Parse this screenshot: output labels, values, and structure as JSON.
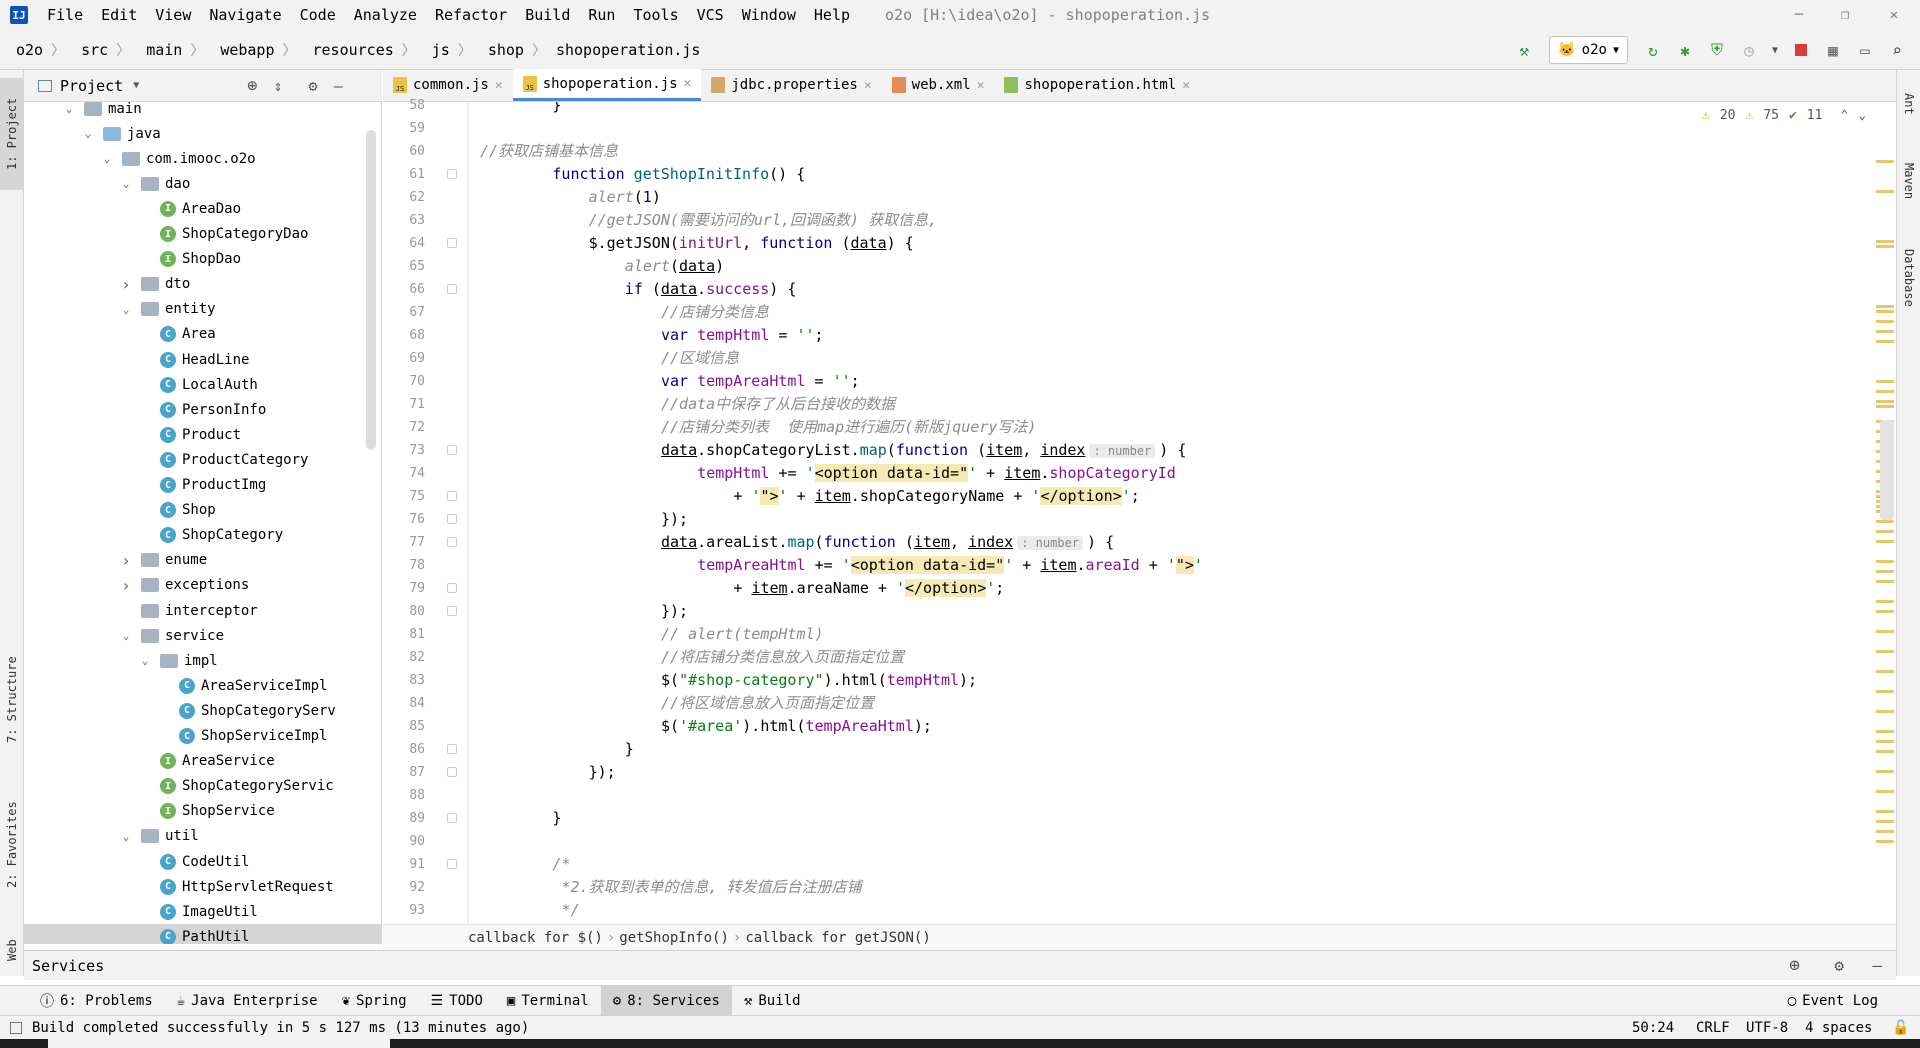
{
  "menu": {
    "items": [
      "File",
      "Edit",
      "View",
      "Navigate",
      "Code",
      "Analyze",
      "Refactor",
      "Build",
      "Run",
      "Tools",
      "VCS",
      "Window",
      "Help"
    ],
    "title": "o2o [H:\\idea\\o2o] - shopoperation.js"
  },
  "breadcrumb": [
    "o2o",
    "src",
    "main",
    "webapp",
    "resources",
    "js",
    "shop",
    "shopoperation.js"
  ],
  "run_config": "o2o",
  "left_tabs": {
    "project": "1: Project",
    "structure": "7: Structure",
    "favorites": "2: Favorites",
    "web": "Web"
  },
  "right_tabs": {
    "ant": "Ant",
    "maven": "Maven",
    "database": "Database"
  },
  "project_panel": {
    "title": "Project"
  },
  "tree": [
    {
      "label": "main",
      "depth": 0,
      "arrow": "open",
      "icon": "folder"
    },
    {
      "label": "java",
      "depth": 1,
      "arrow": "open",
      "icon": "folder-blue"
    },
    {
      "label": "com.imooc.o2o",
      "depth": 2,
      "arrow": "open",
      "icon": "folder"
    },
    {
      "label": "dao",
      "depth": 3,
      "arrow": "open",
      "icon": "folder"
    },
    {
      "label": "AreaDao",
      "depth": 4,
      "arrow": "",
      "icon": "I"
    },
    {
      "label": "ShopCategoryDao",
      "depth": 4,
      "arrow": "",
      "icon": "I"
    },
    {
      "label": "ShopDao",
      "depth": 4,
      "arrow": "",
      "icon": "I"
    },
    {
      "label": "dto",
      "depth": 3,
      "arrow": "closed",
      "icon": "folder"
    },
    {
      "label": "entity",
      "depth": 3,
      "arrow": "open",
      "icon": "folder"
    },
    {
      "label": "Area",
      "depth": 4,
      "arrow": "",
      "icon": "C"
    },
    {
      "label": "HeadLine",
      "depth": 4,
      "arrow": "",
      "icon": "C"
    },
    {
      "label": "LocalAuth",
      "depth": 4,
      "arrow": "",
      "icon": "C"
    },
    {
      "label": "PersonInfo",
      "depth": 4,
      "arrow": "",
      "icon": "C"
    },
    {
      "label": "Product",
      "depth": 4,
      "arrow": "",
      "icon": "C"
    },
    {
      "label": "ProductCategory",
      "depth": 4,
      "arrow": "",
      "icon": "C"
    },
    {
      "label": "ProductImg",
      "depth": 4,
      "arrow": "",
      "icon": "C"
    },
    {
      "label": "Shop",
      "depth": 4,
      "arrow": "",
      "icon": "C"
    },
    {
      "label": "ShopCategory",
      "depth": 4,
      "arrow": "",
      "icon": "C"
    },
    {
      "label": "enume",
      "depth": 3,
      "arrow": "closed",
      "icon": "folder"
    },
    {
      "label": "exceptions",
      "depth": 3,
      "arrow": "closed",
      "icon": "folder"
    },
    {
      "label": "interceptor",
      "depth": 3,
      "arrow": "",
      "icon": "folder"
    },
    {
      "label": "service",
      "depth": 3,
      "arrow": "open",
      "icon": "folder"
    },
    {
      "label": "impl",
      "depth": 4,
      "arrow": "open",
      "icon": "folder"
    },
    {
      "label": "AreaServiceImpl",
      "depth": 5,
      "arrow": "",
      "icon": "C"
    },
    {
      "label": "ShopCategoryServ",
      "depth": 5,
      "arrow": "",
      "icon": "C"
    },
    {
      "label": "ShopServiceImpl",
      "depth": 5,
      "arrow": "",
      "icon": "C"
    },
    {
      "label": "AreaService",
      "depth": 4,
      "arrow": "",
      "icon": "I"
    },
    {
      "label": "ShopCategoryServic",
      "depth": 4,
      "arrow": "",
      "icon": "I"
    },
    {
      "label": "ShopService",
      "depth": 4,
      "arrow": "",
      "icon": "I"
    },
    {
      "label": "util",
      "depth": 3,
      "arrow": "open",
      "icon": "folder"
    },
    {
      "label": "CodeUtil",
      "depth": 4,
      "arrow": "",
      "icon": "C"
    },
    {
      "label": "HttpServletRequest",
      "depth": 4,
      "arrow": "",
      "icon": "C"
    },
    {
      "label": "ImageUtil",
      "depth": 4,
      "arrow": "",
      "icon": "C"
    },
    {
      "label": "PathUtil",
      "depth": 4,
      "arrow": "",
      "icon": "C"
    }
  ],
  "tabs": [
    {
      "label": "common.js",
      "icon": "js",
      "active": false
    },
    {
      "label": "shopoperation.js",
      "icon": "js",
      "active": true
    },
    {
      "label": "jdbc.properties",
      "icon": "prop",
      "active": false
    },
    {
      "label": "web.xml",
      "icon": "xml",
      "active": false
    },
    {
      "label": "shopoperation.html",
      "icon": "html",
      "active": false
    }
  ],
  "inspections": {
    "warn1": "20",
    "warn2": "75",
    "ok": "11"
  },
  "line_numbers": [
    "58",
    "59",
    "60",
    "61",
    "62",
    "63",
    "64",
    "65",
    "66",
    "67",
    "68",
    "69",
    "70",
    "71",
    "72",
    "73",
    "74",
    "75",
    "76",
    "77",
    "78",
    "79",
    "80",
    "81",
    "82",
    "83",
    "84",
    "85",
    "86",
    "87",
    "88",
    "89",
    "90",
    "91",
    "92",
    "93"
  ],
  "code": [
    {
      "indent": 8,
      "tokens": [
        [
          "pl",
          "}"
        ]
      ]
    },
    {
      "indent": 0,
      "tokens": []
    },
    {
      "indent": 0,
      "tokens": [
        [
          "cm",
          "//获取店铺基本信息"
        ]
      ]
    },
    {
      "indent": 8,
      "tokens": [
        [
          "kw",
          "function "
        ],
        [
          "fn",
          "getShopInitInfo"
        ],
        [
          "pl",
          "() {"
        ]
      ]
    },
    {
      "indent": 12,
      "tokens": [
        [
          "cm",
          "alert"
        ],
        [
          "pl",
          "("
        ],
        [
          "kw",
          "1"
        ],
        [
          "pl",
          ")"
        ]
      ]
    },
    {
      "indent": 12,
      "tokens": [
        [
          "cm",
          "//getJSON(需要访问的url,回调函数) 获取信息,"
        ]
      ]
    },
    {
      "indent": 12,
      "tokens": [
        [
          "pl",
          "$.getJSON("
        ],
        [
          "id",
          "initUrl"
        ],
        [
          "pl",
          ", "
        ],
        [
          "kw",
          "function "
        ],
        [
          "pl",
          "("
        ],
        [
          "ul",
          "data"
        ],
        [
          "pl",
          ") {"
        ]
      ]
    },
    {
      "indent": 16,
      "tokens": [
        [
          "cm",
          "alert"
        ],
        [
          "pl",
          "("
        ],
        [
          "ul",
          "data"
        ],
        [
          "pl",
          ")"
        ]
      ]
    },
    {
      "indent": 16,
      "tokens": [
        [
          "kw",
          "if "
        ],
        [
          "pl",
          "("
        ],
        [
          "ul",
          "data"
        ],
        [
          "pl",
          "."
        ],
        [
          "id",
          "success"
        ],
        [
          "pl",
          ") {"
        ]
      ]
    },
    {
      "indent": 20,
      "tokens": [
        [
          "cm",
          "//店铺分类信息"
        ]
      ]
    },
    {
      "indent": 20,
      "tokens": [
        [
          "kw",
          "var "
        ],
        [
          "id",
          "tempHtml"
        ],
        [
          "pl",
          " = "
        ],
        [
          "str",
          "''"
        ],
        [
          "pl",
          ";"
        ]
      ]
    },
    {
      "indent": 20,
      "tokens": [
        [
          "cm",
          "//区域信息"
        ]
      ]
    },
    {
      "indent": 20,
      "tokens": [
        [
          "kw",
          "var "
        ],
        [
          "id",
          "tempAreaHtml"
        ],
        [
          "pl",
          " = "
        ],
        [
          "str",
          "''"
        ],
        [
          "pl",
          ";"
        ]
      ]
    },
    {
      "indent": 20,
      "tokens": [
        [
          "cm",
          "//data中保存了从后台接收的数据"
        ]
      ]
    },
    {
      "indent": 20,
      "tokens": [
        [
          "cm",
          "//店铺分类列表  使用map进行遍历(新版jquery写法)"
        ]
      ]
    },
    {
      "indent": 20,
      "tokens": [
        [
          "ul",
          "data"
        ],
        [
          "pl",
          ".shopCategoryList."
        ],
        [
          "fn",
          "map"
        ],
        [
          "pl",
          "("
        ],
        [
          "kw",
          "function "
        ],
        [
          "pl",
          "("
        ],
        [
          "ul",
          "item"
        ],
        [
          "pl",
          ", "
        ],
        [
          "ul",
          "index"
        ],
        [
          "hint",
          ": number"
        ],
        [
          "pl",
          ") {"
        ]
      ]
    },
    {
      "indent": 24,
      "tokens": [
        [
          "id",
          "tempHtml"
        ],
        [
          "pl",
          " += "
        ],
        [
          "str",
          "'"
        ],
        [
          "hl",
          "<option data-id=\""
        ],
        [
          "str",
          "'"
        ],
        [
          "pl",
          " + "
        ],
        [
          "ul",
          "item"
        ],
        [
          "pl",
          "."
        ],
        [
          "id",
          "shopCategoryId"
        ]
      ]
    },
    {
      "indent": 28,
      "tokens": [
        [
          "pl",
          "+ "
        ],
        [
          "str",
          "'"
        ],
        [
          "hl",
          "\">"
        ],
        [
          "str",
          "'"
        ],
        [
          "pl",
          " + "
        ],
        [
          "ul",
          "item"
        ],
        [
          "pl",
          ".shopCategoryName + "
        ],
        [
          "str",
          "'"
        ],
        [
          "hl",
          "</option>"
        ],
        [
          "str",
          "'"
        ],
        [
          "pl",
          ";"
        ]
      ]
    },
    {
      "indent": 20,
      "tokens": [
        [
          "pl",
          "});"
        ]
      ]
    },
    {
      "indent": 20,
      "tokens": [
        [
          "ul",
          "data"
        ],
        [
          "pl",
          ".areaList."
        ],
        [
          "fn",
          "map"
        ],
        [
          "pl",
          "("
        ],
        [
          "kw",
          "function "
        ],
        [
          "pl",
          "("
        ],
        [
          "ul",
          "item"
        ],
        [
          "pl",
          ", "
        ],
        [
          "ul",
          "index"
        ],
        [
          "hint",
          ": number"
        ],
        [
          "pl",
          ") {"
        ]
      ]
    },
    {
      "indent": 24,
      "tokens": [
        [
          "id",
          "tempAreaHtml"
        ],
        [
          "pl",
          " += "
        ],
        [
          "str",
          "'"
        ],
        [
          "hl",
          "<option data-id=\""
        ],
        [
          "str",
          "'"
        ],
        [
          "pl",
          " + "
        ],
        [
          "ul",
          "item"
        ],
        [
          "pl",
          "."
        ],
        [
          "id",
          "areaId"
        ],
        [
          "pl",
          " + "
        ],
        [
          "str",
          "'"
        ],
        [
          "hl",
          "\">"
        ],
        [
          "str",
          "'"
        ]
      ]
    },
    {
      "indent": 28,
      "tokens": [
        [
          "pl",
          "+ "
        ],
        [
          "ul",
          "item"
        ],
        [
          "pl",
          ".areaName + "
        ],
        [
          "str",
          "'"
        ],
        [
          "hl",
          "</option>"
        ],
        [
          "str",
          "'"
        ],
        [
          "pl",
          ";"
        ]
      ]
    },
    {
      "indent": 20,
      "tokens": [
        [
          "pl",
          "});"
        ]
      ]
    },
    {
      "indent": 20,
      "tokens": [
        [
          "cm",
          "// alert(tempHtml)"
        ]
      ]
    },
    {
      "indent": 20,
      "tokens": [
        [
          "cm",
          "//将店铺分类信息放入页面指定位置"
        ]
      ]
    },
    {
      "indent": 20,
      "tokens": [
        [
          "pl",
          "$("
        ],
        [
          "str",
          "\"#shop-category\""
        ],
        [
          "pl",
          ").html("
        ],
        [
          "id",
          "tempHtml"
        ],
        [
          "pl",
          ");"
        ]
      ]
    },
    {
      "indent": 20,
      "tokens": [
        [
          "cm",
          "//将区域信息放入页面指定位置"
        ]
      ]
    },
    {
      "indent": 20,
      "tokens": [
        [
          "pl",
          "$("
        ],
        [
          "str",
          "'#area'"
        ],
        [
          "pl",
          ").html("
        ],
        [
          "id",
          "tempAreaHtml"
        ],
        [
          "pl",
          ");"
        ]
      ]
    },
    {
      "indent": 16,
      "tokens": [
        [
          "pl",
          "}"
        ]
      ]
    },
    {
      "indent": 12,
      "tokens": [
        [
          "pl",
          "});"
        ]
      ]
    },
    {
      "indent": 0,
      "tokens": []
    },
    {
      "indent": 8,
      "tokens": [
        [
          "pl",
          "}"
        ]
      ]
    },
    {
      "indent": 0,
      "tokens": []
    },
    {
      "indent": 8,
      "tokens": [
        [
          "cm",
          "/*"
        ]
      ]
    },
    {
      "indent": 9,
      "tokens": [
        [
          "cm",
          "*2.获取到表单的信息, 转发值后台注册店铺"
        ]
      ]
    },
    {
      "indent": 9,
      "tokens": [
        [
          "cm",
          "*/"
        ]
      ]
    }
  ],
  "editor_breadcrumb": [
    "callback for $()",
    "getShopInfo()",
    "callback for getJSON()"
  ],
  "services": {
    "title": "Services"
  },
  "toolwindows": [
    {
      "label": "6: Problems",
      "icon": "problems-icon",
      "active": false
    },
    {
      "label": "Java Enterprise",
      "icon": "java-enterprise-icon",
      "active": false
    },
    {
      "label": "Spring",
      "icon": "spring-icon",
      "active": false
    },
    {
      "label": "TODO",
      "icon": "todo-icon",
      "active": false
    },
    {
      "label": "Terminal",
      "icon": "terminal-icon",
      "active": false
    },
    {
      "label": "8: Services",
      "icon": "services-icon",
      "active": true
    },
    {
      "label": "Build",
      "icon": "build-icon",
      "active": false
    }
  ],
  "event_log": "Event Log",
  "status": {
    "message": "Build completed successfully in 5 s 127 ms (13 minutes ago)",
    "position": "50:24",
    "line_sep": "CRLF",
    "encoding": "UTF-8",
    "indent": "4 spaces"
  }
}
